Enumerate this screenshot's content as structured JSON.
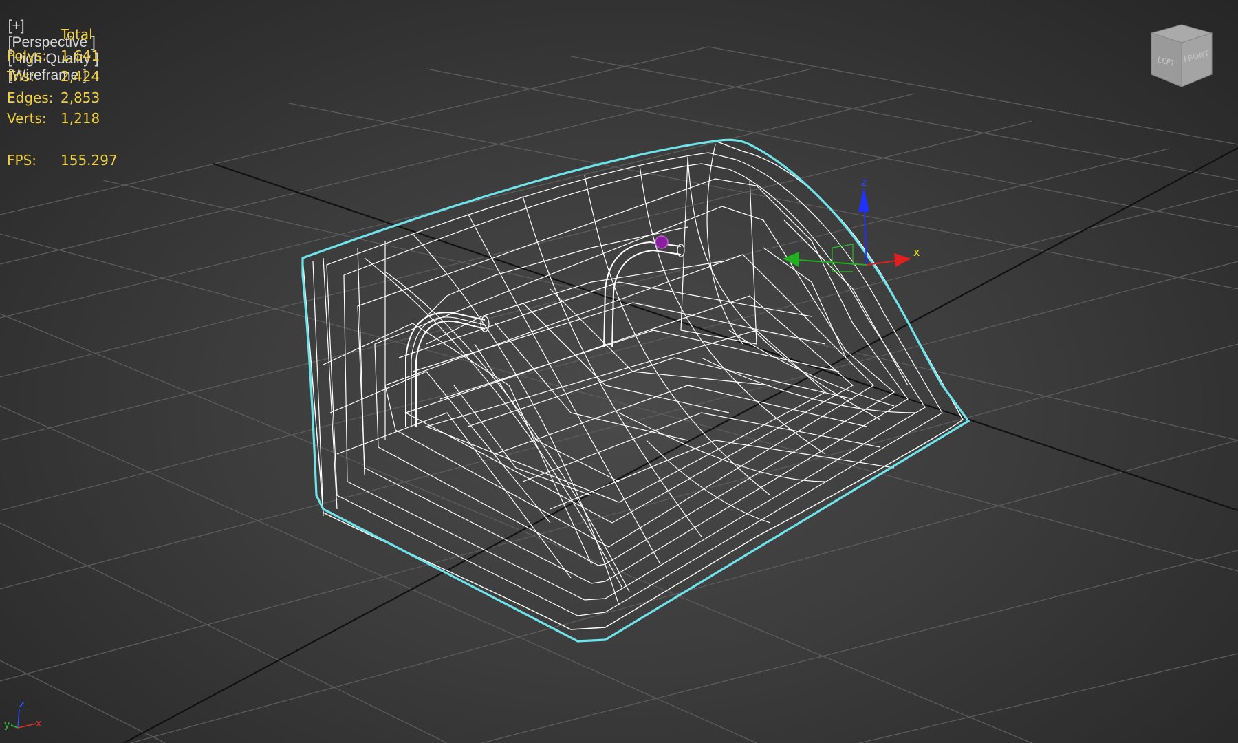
{
  "viewport": {
    "label_plus": "[+]",
    "label_view": "[Perspective ]",
    "label_quality": "[High Quality ]",
    "label_shading": "[Wireframe ]"
  },
  "stats": {
    "header": "Total",
    "polys_label": "Polys:",
    "polys": "1,641",
    "tris_label": "Tris:",
    "tris": "2,424",
    "edges_label": "Edges:",
    "edges": "2,853",
    "verts_label": "Verts:",
    "verts": "1,218",
    "fps_label": "FPS:",
    "fps": "155.297"
  },
  "viewcube": {
    "left": "LEFT",
    "front": "FRONT"
  },
  "gizmo": {
    "x": "x",
    "z": "z"
  },
  "tripod": {
    "x": "x",
    "y": "y",
    "z": "z"
  },
  "colors": {
    "selection_outline": "#6fe3ea",
    "wire": "#ffffff",
    "stats_text": "#f0d040",
    "grid": "#555555",
    "grid_axis": "#111111"
  }
}
